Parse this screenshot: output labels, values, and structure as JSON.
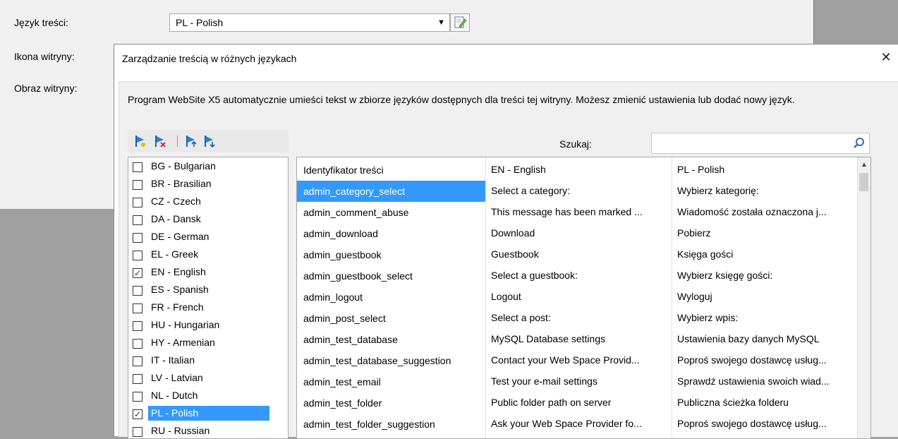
{
  "background": {
    "content_language_label": "Język treści:",
    "site_icon_label": "Ikona witryny:",
    "site_image_label": "Obraz witryny:",
    "language_select_value": "PL - Polish"
  },
  "dialog": {
    "title": "Zarządzanie treścią w różnych językach",
    "close_label": "✕",
    "description": "Program WebSite X5 automatycznie umieści tekst w zbiorze języków dostępnych dla treści tej witryny. Możesz zmienić ustawienia lub dodać nowy język.",
    "search_label": "Szukaj:",
    "search_value": ""
  },
  "languages": [
    {
      "label": "BG - Bulgarian",
      "checked": false,
      "selected": false
    },
    {
      "label": "BR - Brasilian",
      "checked": false,
      "selected": false
    },
    {
      "label": "CZ - Czech",
      "checked": false,
      "selected": false
    },
    {
      "label": "DA - Dansk",
      "checked": false,
      "selected": false
    },
    {
      "label": "DE - German",
      "checked": false,
      "selected": false
    },
    {
      "label": "EL - Greek",
      "checked": false,
      "selected": false
    },
    {
      "label": "EN - English",
      "checked": true,
      "selected": false
    },
    {
      "label": "ES - Spanish",
      "checked": false,
      "selected": false
    },
    {
      "label": "FR - French",
      "checked": false,
      "selected": false
    },
    {
      "label": "HU - Hungarian",
      "checked": false,
      "selected": false
    },
    {
      "label": "HY - Armenian",
      "checked": false,
      "selected": false
    },
    {
      "label": "IT - Italian",
      "checked": false,
      "selected": false
    },
    {
      "label": "LV - Latvian",
      "checked": false,
      "selected": false
    },
    {
      "label": "NL - Dutch",
      "checked": false,
      "selected": false
    },
    {
      "label": "PL - Polish",
      "checked": true,
      "selected": true
    },
    {
      "label": "RU - Russian",
      "checked": false,
      "selected": false
    }
  ],
  "table": {
    "headers": [
      "Identyfikator treści",
      "EN - English",
      "PL - Polish"
    ],
    "rows": [
      [
        "admin_category_select",
        "Select a category:",
        "Wybierz kategorię:"
      ],
      [
        "admin_comment_abuse",
        "This message has been marked ...",
        "Wiadomość została oznaczona j..."
      ],
      [
        "admin_download",
        "Download",
        "Pobierz"
      ],
      [
        "admin_guestbook",
        "Guestbook",
        "Księga gości"
      ],
      [
        "admin_guestbook_select",
        "Select a guestbook:",
        "Wybierz księgę gości:"
      ],
      [
        "admin_logout",
        "Logout",
        "Wyloguj"
      ],
      [
        "admin_post_select",
        "Select a post:",
        "Wybierz wpis:"
      ],
      [
        "admin_test_database",
        "MySQL Database settings",
        "Ustawienia bazy danych MySQL"
      ],
      [
        "admin_test_database_suggestion",
        "Contact your Web Space Provid...",
        "Poproś swojego dostawcę usług..."
      ],
      [
        "admin_test_email",
        "Test your e-mail settings",
        "Sprawdź ustawienia swoich wiad..."
      ],
      [
        "admin_test_folder",
        "Public folder path on server",
        "Publiczna ścieżka folderu"
      ],
      [
        "admin_test_folder_suggestion",
        "Ask your Web Space Provider fo...",
        "Poproś swojego dostawcę usług..."
      ]
    ],
    "selected_row": 0
  },
  "colors": {
    "selection": "#3399ff",
    "panel_bg": "#f0f0f0",
    "backdrop": "#a0a0a0"
  },
  "icons": {
    "toolbar": [
      "add-language-icon",
      "remove-language-icon",
      "move-up-icon",
      "move-down-icon"
    ],
    "search": "search-icon",
    "edit": "edit-icon",
    "dropdown": "chevron-down-icon"
  }
}
